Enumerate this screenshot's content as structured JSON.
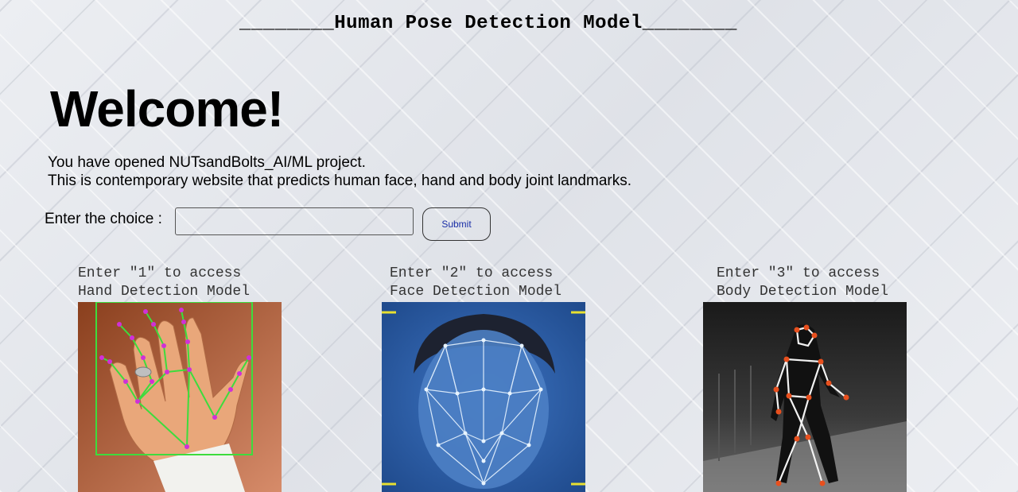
{
  "header": {
    "title": "________Human Pose Detection Model________"
  },
  "welcome": {
    "heading": "Welcome!",
    "line1": "You have opened NUTsandBolts_AI/ML project.",
    "line2": "This is contemporary website that predicts human face, hand and body joint landmarks."
  },
  "form": {
    "label": "Enter the choice :",
    "input_value": "",
    "input_placeholder": "",
    "submit_label": "Submit"
  },
  "cards": [
    {
      "caption_line1": "Enter \"1\" to access",
      "caption_line2": "Hand Detection Model",
      "image": "hand-landmarks-image"
    },
    {
      "caption_line1": "Enter \"2\" to access",
      "caption_line2": "Face Detection Model",
      "image": "face-mesh-image"
    },
    {
      "caption_line1": "Enter \"3\" to access",
      "caption_line2": "Body Detection Model",
      "image": "body-pose-image"
    }
  ],
  "colors": {
    "background": "#e4e6ec",
    "submit_text": "#1a2fa8",
    "hand_bg": "#c55a2a",
    "hand_box": "#3ddc3d",
    "hand_joint": "#d030d8",
    "face_bg": "#2d5fa8",
    "face_mesh": "#e8f4ff",
    "face_corner": "#e8e030",
    "body_bg": "#2a2a2a",
    "body_joint": "#e8501e"
  }
}
